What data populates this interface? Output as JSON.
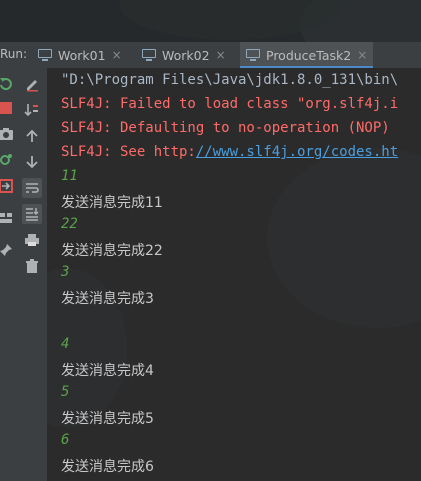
{
  "run_panel": {
    "label": "Run:",
    "tabs": [
      {
        "label": "Work01",
        "close": "×"
      },
      {
        "label": "Work02",
        "close": "×"
      },
      {
        "label": "ProduceTask2",
        "close": "×"
      }
    ]
  },
  "toolbar": {
    "icons": [
      "rerun-icon",
      "edit-config-icon",
      "stop-icon",
      "sort-icon",
      "camera-icon",
      "up-arrow-icon",
      "settings-icon",
      "down-arrow-icon",
      "exit-icon",
      "soft-wrap-icon",
      "layout-icon",
      "scroll-to-end-icon",
      "pin-icon",
      "print-icon",
      "trash-icon"
    ]
  },
  "console": {
    "command_line": "\"D:\\Program Files\\Java\\jdk1.8.0_131\\bin\\",
    "slf4j_1": "SLF4J: Failed to load class \"org.slf4j.i",
    "slf4j_2": "SLF4J: Defaulting to no-operation (NOP)",
    "slf4j_3_prefix": "SLF4J: See http:",
    "slf4j_3_link": "//www.slf4j.org/codes.ht",
    "entries": [
      {
        "num": "11",
        "msg": "发送消息完成11"
      },
      {
        "num": "22",
        "msg": "发送消息完成22"
      },
      {
        "num": "3",
        "msg": "发送消息完成3"
      },
      {
        "num": "4",
        "msg": "发送消息完成4"
      },
      {
        "num": "5",
        "msg": "发送消息完成5"
      },
      {
        "num": "6",
        "msg": "发送消息完成6"
      }
    ]
  },
  "colors": {
    "error_text": "#ff6b68",
    "link": "#4a9fe0",
    "number_green": "#5aa34a",
    "active_tab_underline": "#4a88c7"
  }
}
